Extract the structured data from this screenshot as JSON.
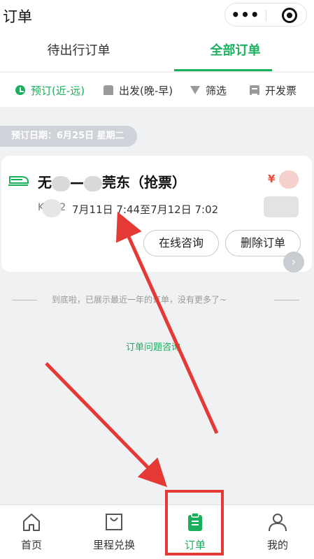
{
  "header": {
    "title": "订单",
    "more_symbol": "•••"
  },
  "tabs": [
    {
      "label": "待出行订单",
      "active": false
    },
    {
      "label": "全部订单",
      "active": true
    }
  ],
  "filters": [
    {
      "label": "预订(近-远)",
      "icon": "clock-icon",
      "active": true
    },
    {
      "label": "出发(晚-早)",
      "icon": "building-icon",
      "active": false
    },
    {
      "label": "筛选",
      "icon": "funnel-icon",
      "active": false
    },
    {
      "label": "开发票",
      "icon": "invoice-icon",
      "active": false
    }
  ],
  "booking_date": "预订日期：6月25日 星期二",
  "order": {
    "route_prefix": "无",
    "route_dash": "—",
    "route_suffix": "莞东（抢票）",
    "price_symbol": "¥",
    "train_no_prefix": "K",
    "train_no_suffix": "2",
    "travel_time": "7月11日 7:44至7月12日 7:02",
    "consult_button": "在线咨询",
    "delete_button": "删除订单"
  },
  "end_message": "到底啦，已展示最近一年的订单，没有更多了~",
  "help_link": "订单问题咨询",
  "bottom_nav": [
    {
      "label": "首页",
      "icon": "home-icon",
      "active": false
    },
    {
      "label": "里程兑换",
      "icon": "shopping-bag-icon",
      "active": false
    },
    {
      "label": "订单",
      "icon": "clipboard-icon",
      "active": true
    },
    {
      "label": "我的",
      "icon": "user-icon",
      "active": false
    }
  ],
  "colors": {
    "accent": "#1aaf5d",
    "price": "#f04b3a",
    "annotation": "#e53935"
  }
}
